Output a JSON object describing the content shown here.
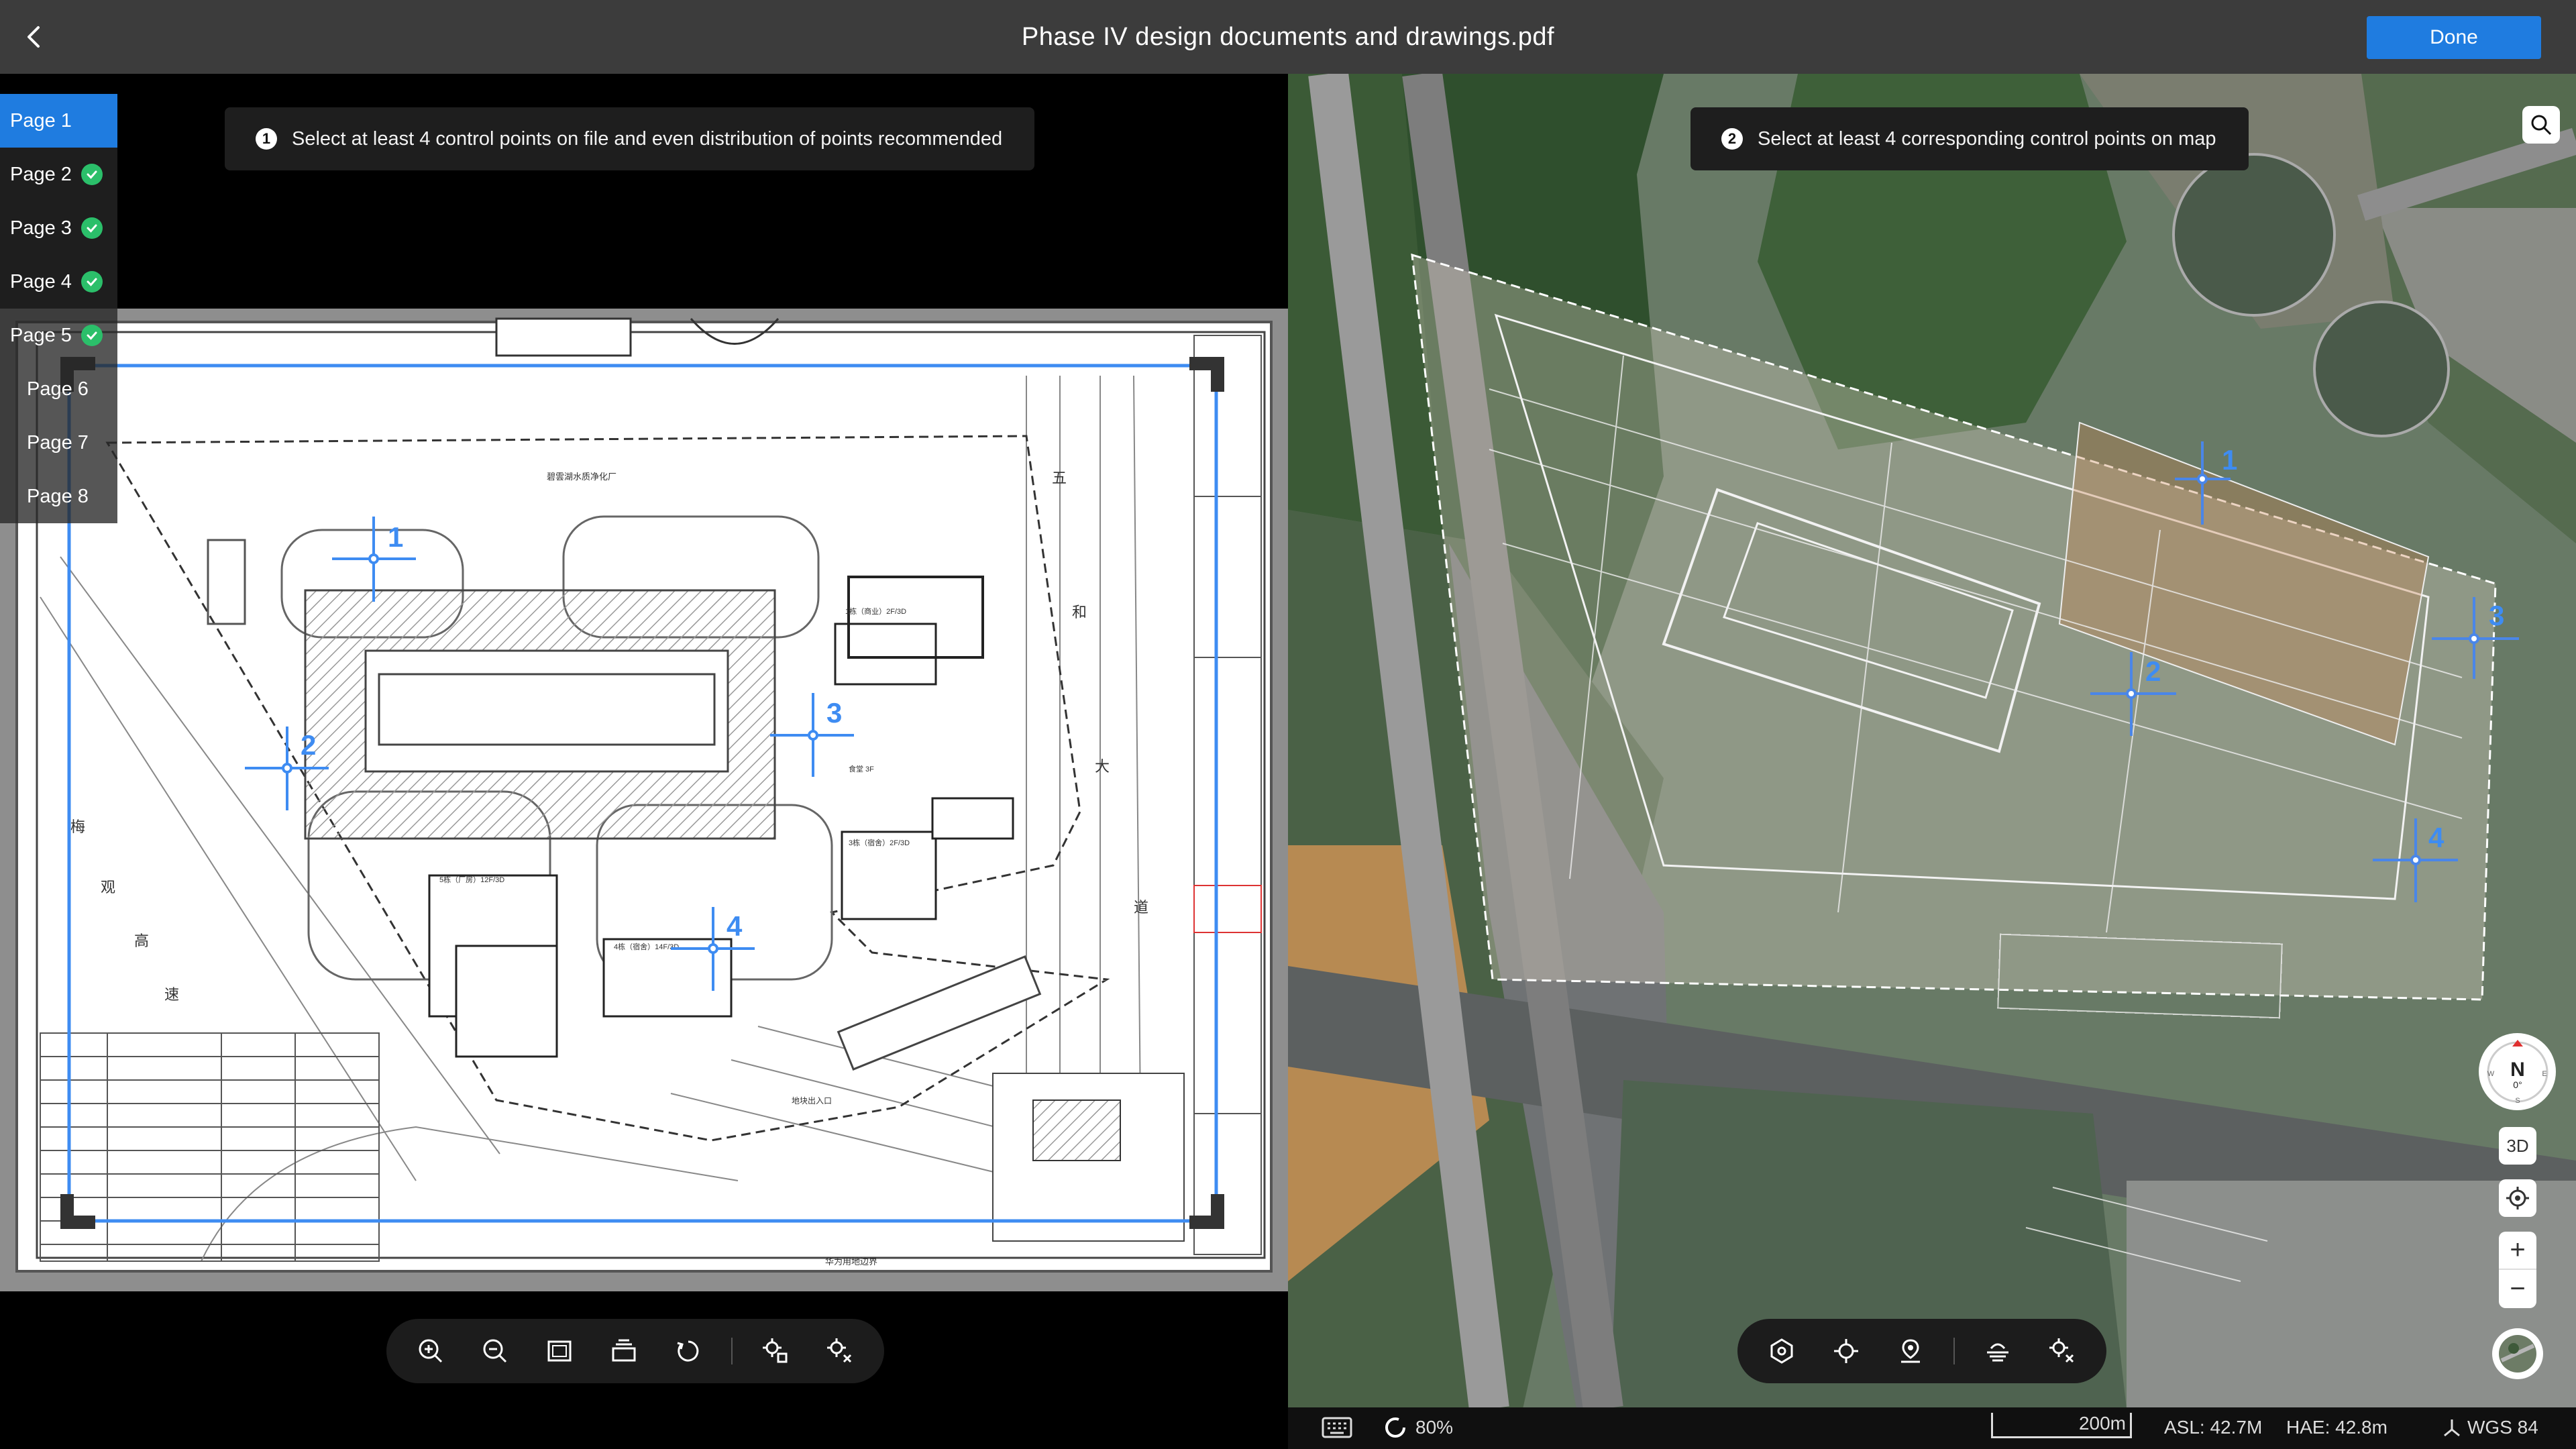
{
  "header": {
    "title": "Phase IV design documents and drawings.pdf",
    "done_label": "Done"
  },
  "pages": [
    {
      "label": "Page 1",
      "state": "active"
    },
    {
      "label": "Page 2",
      "state": "done"
    },
    {
      "label": "Page 3",
      "state": "done"
    },
    {
      "label": "Page 4",
      "state": "done"
    },
    {
      "label": "Page 5",
      "state": "done"
    },
    {
      "label": "Page 6",
      "state": "pending"
    },
    {
      "label": "Page 7",
      "state": "pending"
    },
    {
      "label": "Page 8",
      "state": "pending"
    }
  ],
  "left_panel": {
    "tip_number": "1",
    "tip": "Select at least 4 control points on file and even distribution of points recommended"
  },
  "right_panel": {
    "tip_number": "2",
    "tip": "Select at least 4 corresponding control points on map"
  },
  "control_points_file": [
    "1",
    "2",
    "3",
    "4"
  ],
  "control_points_map": [
    "1",
    "2",
    "3",
    "4"
  ],
  "left_toolbar": [
    "zoom-in-icon",
    "zoom-out-icon",
    "fit-page-icon",
    "layer-icon",
    "rotate-icon",
    "select-point-icon",
    "delete-point-icon"
  ],
  "right_toolbar": [
    "polygon-icon",
    "target-icon",
    "pin-icon",
    "level-icon",
    "delete-point-icon"
  ],
  "map_controls": {
    "compass_dir": "N",
    "compass_deg": "0°",
    "e": "E",
    "w": "W",
    "s": "S",
    "view_3d": "3D",
    "zoom_in": "+",
    "zoom_out": "−"
  },
  "status": {
    "opacity": "80%",
    "scale": "200m",
    "asl": "ASL: 42.7M",
    "hae": "HAE: 42.8m",
    "crs": "WGS 84"
  },
  "drawing_text": {
    "top_building": "碧雲湖水质净化厂",
    "road_chars": [
      "五",
      "和",
      "大",
      "道"
    ],
    "left_chars": [
      "梅",
      "观",
      "高",
      "速"
    ],
    "b1": "5栋（厂房）12F/3D",
    "b2": "1栋（商业）2F/3D",
    "b3": "3栋（宿舍）2F/3D",
    "b4": "4栋（宿舍）14F/3D",
    "b5": "食堂 3F",
    "bottom": "华为用地边界",
    "entrance": "地块出入口"
  },
  "colors": {
    "accent": "#1f7ce0",
    "check": "#2bbf6a",
    "control_point": "#3e8cf2"
  }
}
